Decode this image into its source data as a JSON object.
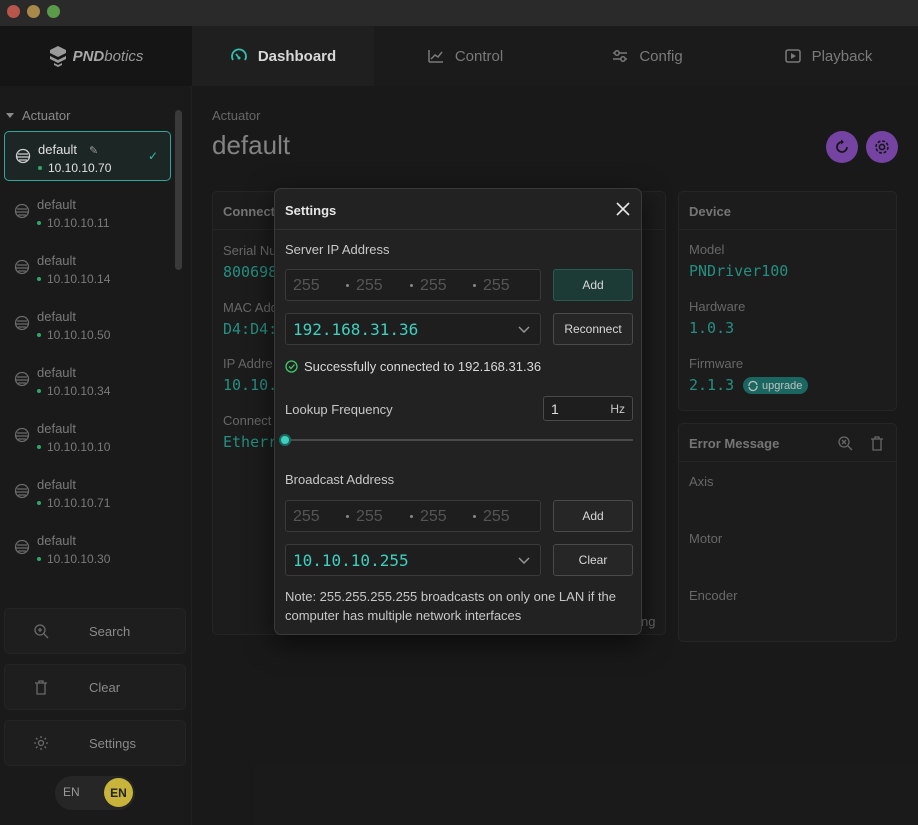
{
  "nav": {
    "brand": "PNDbotics",
    "brand_bold": "PND",
    "brand_rest": "botics",
    "tabs": [
      {
        "label": "Dashboard",
        "icon": "gauge-icon",
        "active": true
      },
      {
        "label": "Control",
        "icon": "trend-icon",
        "active": false
      },
      {
        "label": "Config",
        "icon": "sliders-icon",
        "active": false
      },
      {
        "label": "Playback",
        "icon": "play-box-icon",
        "active": false
      }
    ]
  },
  "sidebar": {
    "heading": "Actuator",
    "devices": [
      {
        "name": "default",
        "ip": "10.10.10.70",
        "selected": true
      },
      {
        "name": "default",
        "ip": "10.10.10.11",
        "selected": false
      },
      {
        "name": "default",
        "ip": "10.10.10.14",
        "selected": false
      },
      {
        "name": "default",
        "ip": "10.10.10.50",
        "selected": false
      },
      {
        "name": "default",
        "ip": "10.10.10.34",
        "selected": false
      },
      {
        "name": "default",
        "ip": "10.10.10.10",
        "selected": false
      },
      {
        "name": "default",
        "ip": "10.10.10.71",
        "selected": false
      },
      {
        "name": "default",
        "ip": "10.10.10.30",
        "selected": false
      }
    ],
    "search_label": "Search",
    "clear_label": "Clear",
    "settings_label": "Settings",
    "lang_left": "EN",
    "lang_right": "EN"
  },
  "main": {
    "subtitle": "Actuator",
    "title": "default",
    "connection": {
      "head": "Connect",
      "serial_label": "Serial Nu",
      "serial_value": "800698",
      "mac_label": "MAC Add",
      "mac_value": "D4:D4:",
      "ip_label": "IP Addre",
      "ip_value": "10.10.",
      "conn_label": "Connect",
      "conn_value": "Etherr",
      "trailing": "ng"
    },
    "device": {
      "head": "Device",
      "model_label": "Model",
      "model_value": "PNDriver100",
      "hardware_label": "Hardware",
      "hardware_value": "1.0.3",
      "firmware_label": "Firmware",
      "firmware_value": "2.1.3",
      "upgrade_label": "upgrade"
    },
    "error": {
      "head": "Error Message",
      "axis_label": "Axis",
      "motor_label": "Motor",
      "encoder_label": "Encoder"
    }
  },
  "modal": {
    "title": "Settings",
    "server_label": "Server IP Address",
    "ip_placeholder": [
      "255",
      "255",
      "255",
      "255"
    ],
    "add_label": "Add",
    "server_selected": "192.168.31.36",
    "reconnect_label": "Reconnect",
    "success_text": "Successfully connected to 192.168.31.36",
    "lookup_label": "Lookup Frequency",
    "lookup_value": "1",
    "lookup_unit": "Hz",
    "broadcast_label": "Broadcast Address",
    "broadcast_add_label": "Add",
    "broadcast_selected": "10.10.10.255",
    "clear_label": "Clear",
    "note": "Note: 255.255.255.255 broadcasts on only one LAN if the computer has multiple network interfaces"
  },
  "colors": {
    "accent": "#3ed0bf",
    "purple": "#8a4fbf",
    "success": "#2fa869"
  }
}
